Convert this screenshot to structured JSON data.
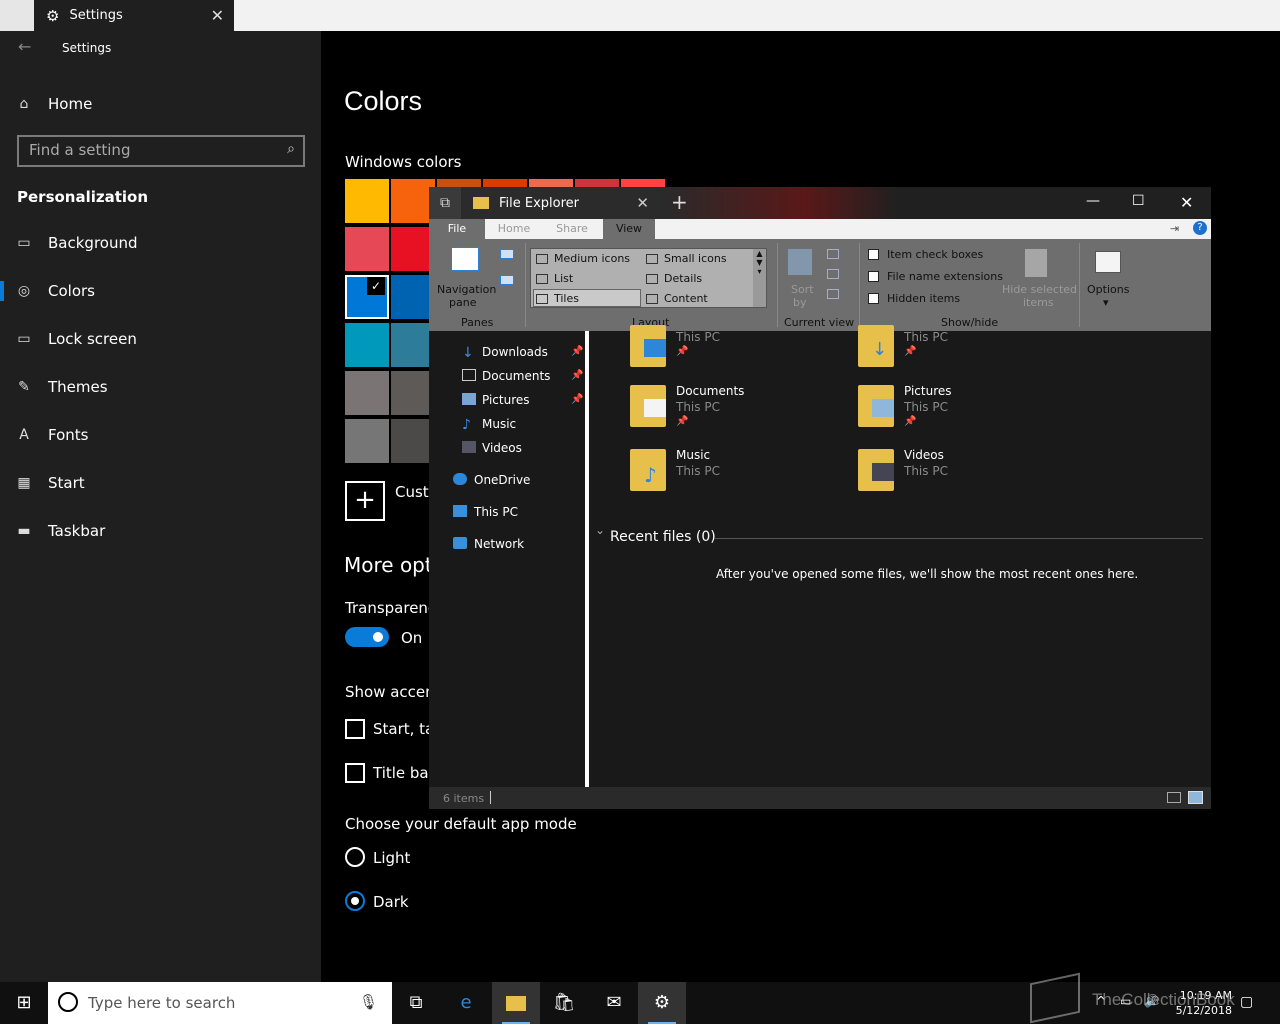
{
  "settings_tab": {
    "title": "Settings"
  },
  "sidebar": {
    "app_title": "Settings",
    "home": "Home",
    "search_placeholder": "Find a setting",
    "section": "Personalization",
    "items": [
      {
        "label": "Background",
        "icon": "image-icon"
      },
      {
        "label": "Colors",
        "icon": "palette-icon"
      },
      {
        "label": "Lock screen",
        "icon": "monitor-icon"
      },
      {
        "label": "Themes",
        "icon": "brush-icon"
      },
      {
        "label": "Fonts",
        "icon": "font-icon"
      },
      {
        "label": "Start",
        "icon": "start-icon"
      },
      {
        "label": "Taskbar",
        "icon": "taskbar-icon"
      }
    ],
    "active": "Colors"
  },
  "main": {
    "title": "Colors",
    "windows_colors": "Windows colors",
    "custom_label": "Custo",
    "more_options": "More opti",
    "transparency": "Transparency",
    "transparency_state": "On",
    "show_accent": "Show accent",
    "start_task": "Start, tas",
    "title_bars": "Title bars",
    "app_mode": "Choose your default app mode",
    "light": "Light",
    "dark": "Dark",
    "selected_mode": "Dark",
    "swatches": [
      "#FFB900",
      "#F7630C",
      "#E74856",
      "#E81123",
      "#0078D7",
      "#0063B1",
      "#0099BC",
      "#2D7D9A",
      "#7A7574",
      "#5D5A58",
      "#767676",
      "#4C4A48"
    ],
    "top_row_colors": [
      "#CA5010",
      "#DA3B01",
      "#EF6950",
      "#D13438",
      "#FF4343"
    ]
  },
  "explorer": {
    "title": "File Explorer",
    "ribbon_tabs": [
      "File",
      "Home",
      "Share",
      "View"
    ],
    "panes": {
      "nav_label": "Navigation",
      "nav_label2": "pane",
      "group": "Panes"
    },
    "layout": {
      "items": [
        "Medium icons",
        "Small icons",
        "List",
        "Details",
        "Tiles",
        "Content"
      ],
      "group": "Layout"
    },
    "current_view": {
      "sort": "Sort",
      "by": "by",
      "group": "Current view"
    },
    "show_hide": {
      "checks": [
        "Item check boxes",
        "File name extensions",
        "Hidden items"
      ],
      "hide_selected": "Hide selected",
      "hide_selected2": "items",
      "group": "Show/hide"
    },
    "options": "Options",
    "nav": [
      "Downloads",
      "Documents",
      "Pictures",
      "Music",
      "Videos",
      "OneDrive",
      "This PC",
      "Network"
    ],
    "tiles": [
      {
        "name": "",
        "sub": "This PC"
      },
      {
        "name": "",
        "sub": "This PC"
      },
      {
        "name": "Documents",
        "sub": "This PC"
      },
      {
        "name": "Pictures",
        "sub": "This PC"
      },
      {
        "name": "Music",
        "sub": "This PC"
      },
      {
        "name": "Videos",
        "sub": "This PC"
      }
    ],
    "recent_title": "Recent files (0)",
    "recent_msg": "After you've opened some files, we'll show the most recent ones here.",
    "status": "6 items"
  },
  "taskbar": {
    "search_placeholder": "Type here to search",
    "time": "10:19 AM",
    "date": "5/12/2018"
  },
  "watermark": "TheCollectionBook"
}
